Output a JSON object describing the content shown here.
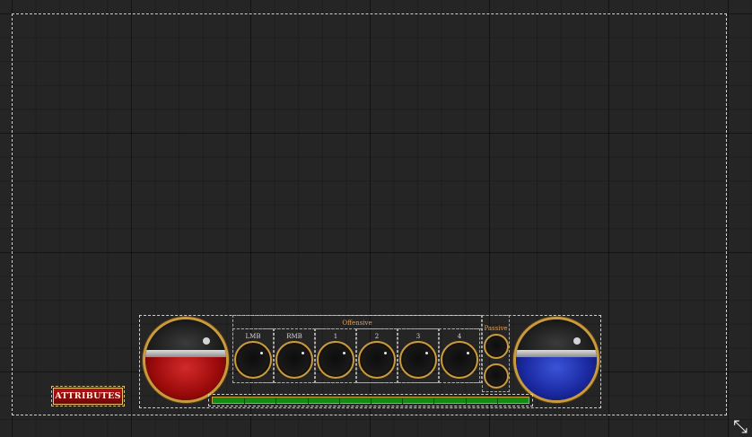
{
  "attributes_button": {
    "label": "ATTRIBUTES",
    "color": "#b2121b"
  },
  "health_orb": {
    "level": 0.58,
    "color": "#9d0b0b"
  },
  "mana_orb": {
    "level": 0.58,
    "color": "#1b2aa2"
  },
  "skill_bar": {
    "offensive_label": "Offensive",
    "passive_label": "Passive",
    "slots": [
      {
        "label": "LMB"
      },
      {
        "label": "RMB"
      },
      {
        "label": "1"
      },
      {
        "label": "2"
      },
      {
        "label": "3"
      },
      {
        "label": "4"
      }
    ],
    "passive_slot_count": 2
  },
  "experience_bar": {
    "progress": 1.0,
    "color": "#138a13"
  },
  "icons": {
    "resize": "resize-diagonal-icon"
  }
}
